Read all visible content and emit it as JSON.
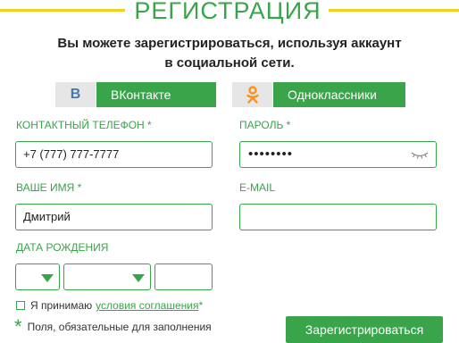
{
  "header": {
    "title": "РЕГИСТРАЦИЯ"
  },
  "subtitle": {
    "line1": "Вы можете зарегистрироваться, используя аккаунт",
    "line2": "в социальной сети."
  },
  "social": {
    "vk": {
      "icon_text": "В",
      "label": "ВКонтакте"
    },
    "ok": {
      "label": "Одноклассники"
    }
  },
  "colors": {
    "accent": "#3aa44a",
    "rule": "#f2d21c",
    "icon_bg": "#e6e6e6",
    "ok_orange": "#f7931e",
    "vk_blue": "#4a76a8"
  },
  "form": {
    "phone": {
      "label": "КОНТАКТНЫЙ ТЕЛЕФОН *",
      "value": "+7 (777) 777-7777"
    },
    "password": {
      "label": "ПАРОЛЬ *",
      "value": "••••••••"
    },
    "name": {
      "label": "ВАШЕ ИМЯ *",
      "value": "Дмитрий"
    },
    "email": {
      "label": "E-MAIL",
      "value": ""
    },
    "birthdate": {
      "label": "ДАТА РОЖДЕНИЯ"
    }
  },
  "agreement": {
    "text": "Я принимаю",
    "link": "условия соглашения",
    "asterisk": "*"
  },
  "required_note": {
    "star": "*",
    "text": "Поля, обязательные для заполнения"
  },
  "submit": {
    "label": "Зарегистрироваться"
  }
}
